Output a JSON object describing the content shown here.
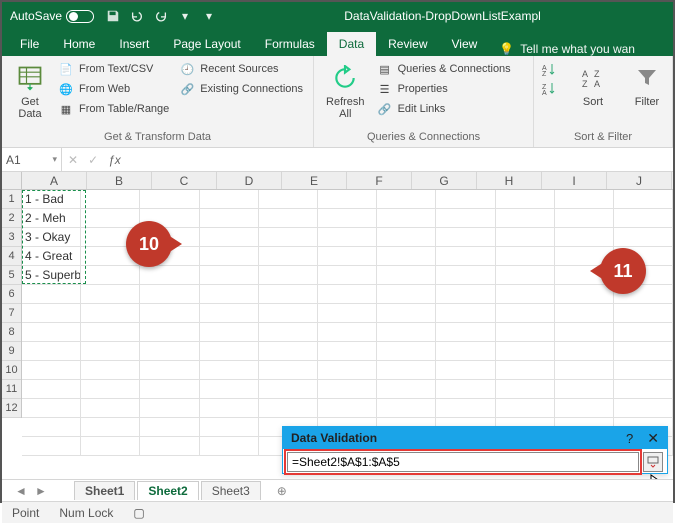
{
  "titlebar": {
    "autosave_label": "AutoSave",
    "autosave_state": "On",
    "doc_name": "DataValidation-DropDownListExampl"
  },
  "tabs": {
    "file": "File",
    "home": "Home",
    "insert": "Insert",
    "pagelayout": "Page Layout",
    "formulas": "Formulas",
    "data": "Data",
    "review": "Review",
    "view": "View",
    "tellme": "Tell me what you wan"
  },
  "ribbon": {
    "group1": {
      "big": "Get\nData",
      "a": "From Text/CSV",
      "b": "From Web",
      "c": "From Table/Range",
      "d": "Recent Sources",
      "e": "Existing Connections",
      "label": "Get & Transform Data"
    },
    "group2": {
      "big": "Refresh\nAll",
      "a": "Queries & Connections",
      "b": "Properties",
      "c": "Edit Links",
      "label": "Queries & Connections"
    },
    "group3": {
      "sort": "Sort",
      "filter": "Filter",
      "label": "Sort & Filter"
    }
  },
  "namebox": "A1",
  "columns": [
    "A",
    "B",
    "C",
    "D",
    "E",
    "F",
    "G",
    "H",
    "I",
    "J"
  ],
  "rownums": [
    "1",
    "2",
    "3",
    "4",
    "5",
    "6",
    "7",
    "8",
    "9",
    "10",
    "11",
    "12"
  ],
  "data_rows": [
    "1 - Bad",
    "2 - Meh",
    "3 - Okay",
    "4 - Great",
    "5 - Superb"
  ],
  "dialog": {
    "title": "Data Validation",
    "formula": "=Sheet2!$A$1:$A$5"
  },
  "sheets": {
    "s1": "Sheet1",
    "s2": "Sheet2",
    "s3": "Sheet3"
  },
  "status": {
    "mode": "Point",
    "numlock": "Num Lock"
  },
  "badges": {
    "b10": "10",
    "b11": "11"
  }
}
